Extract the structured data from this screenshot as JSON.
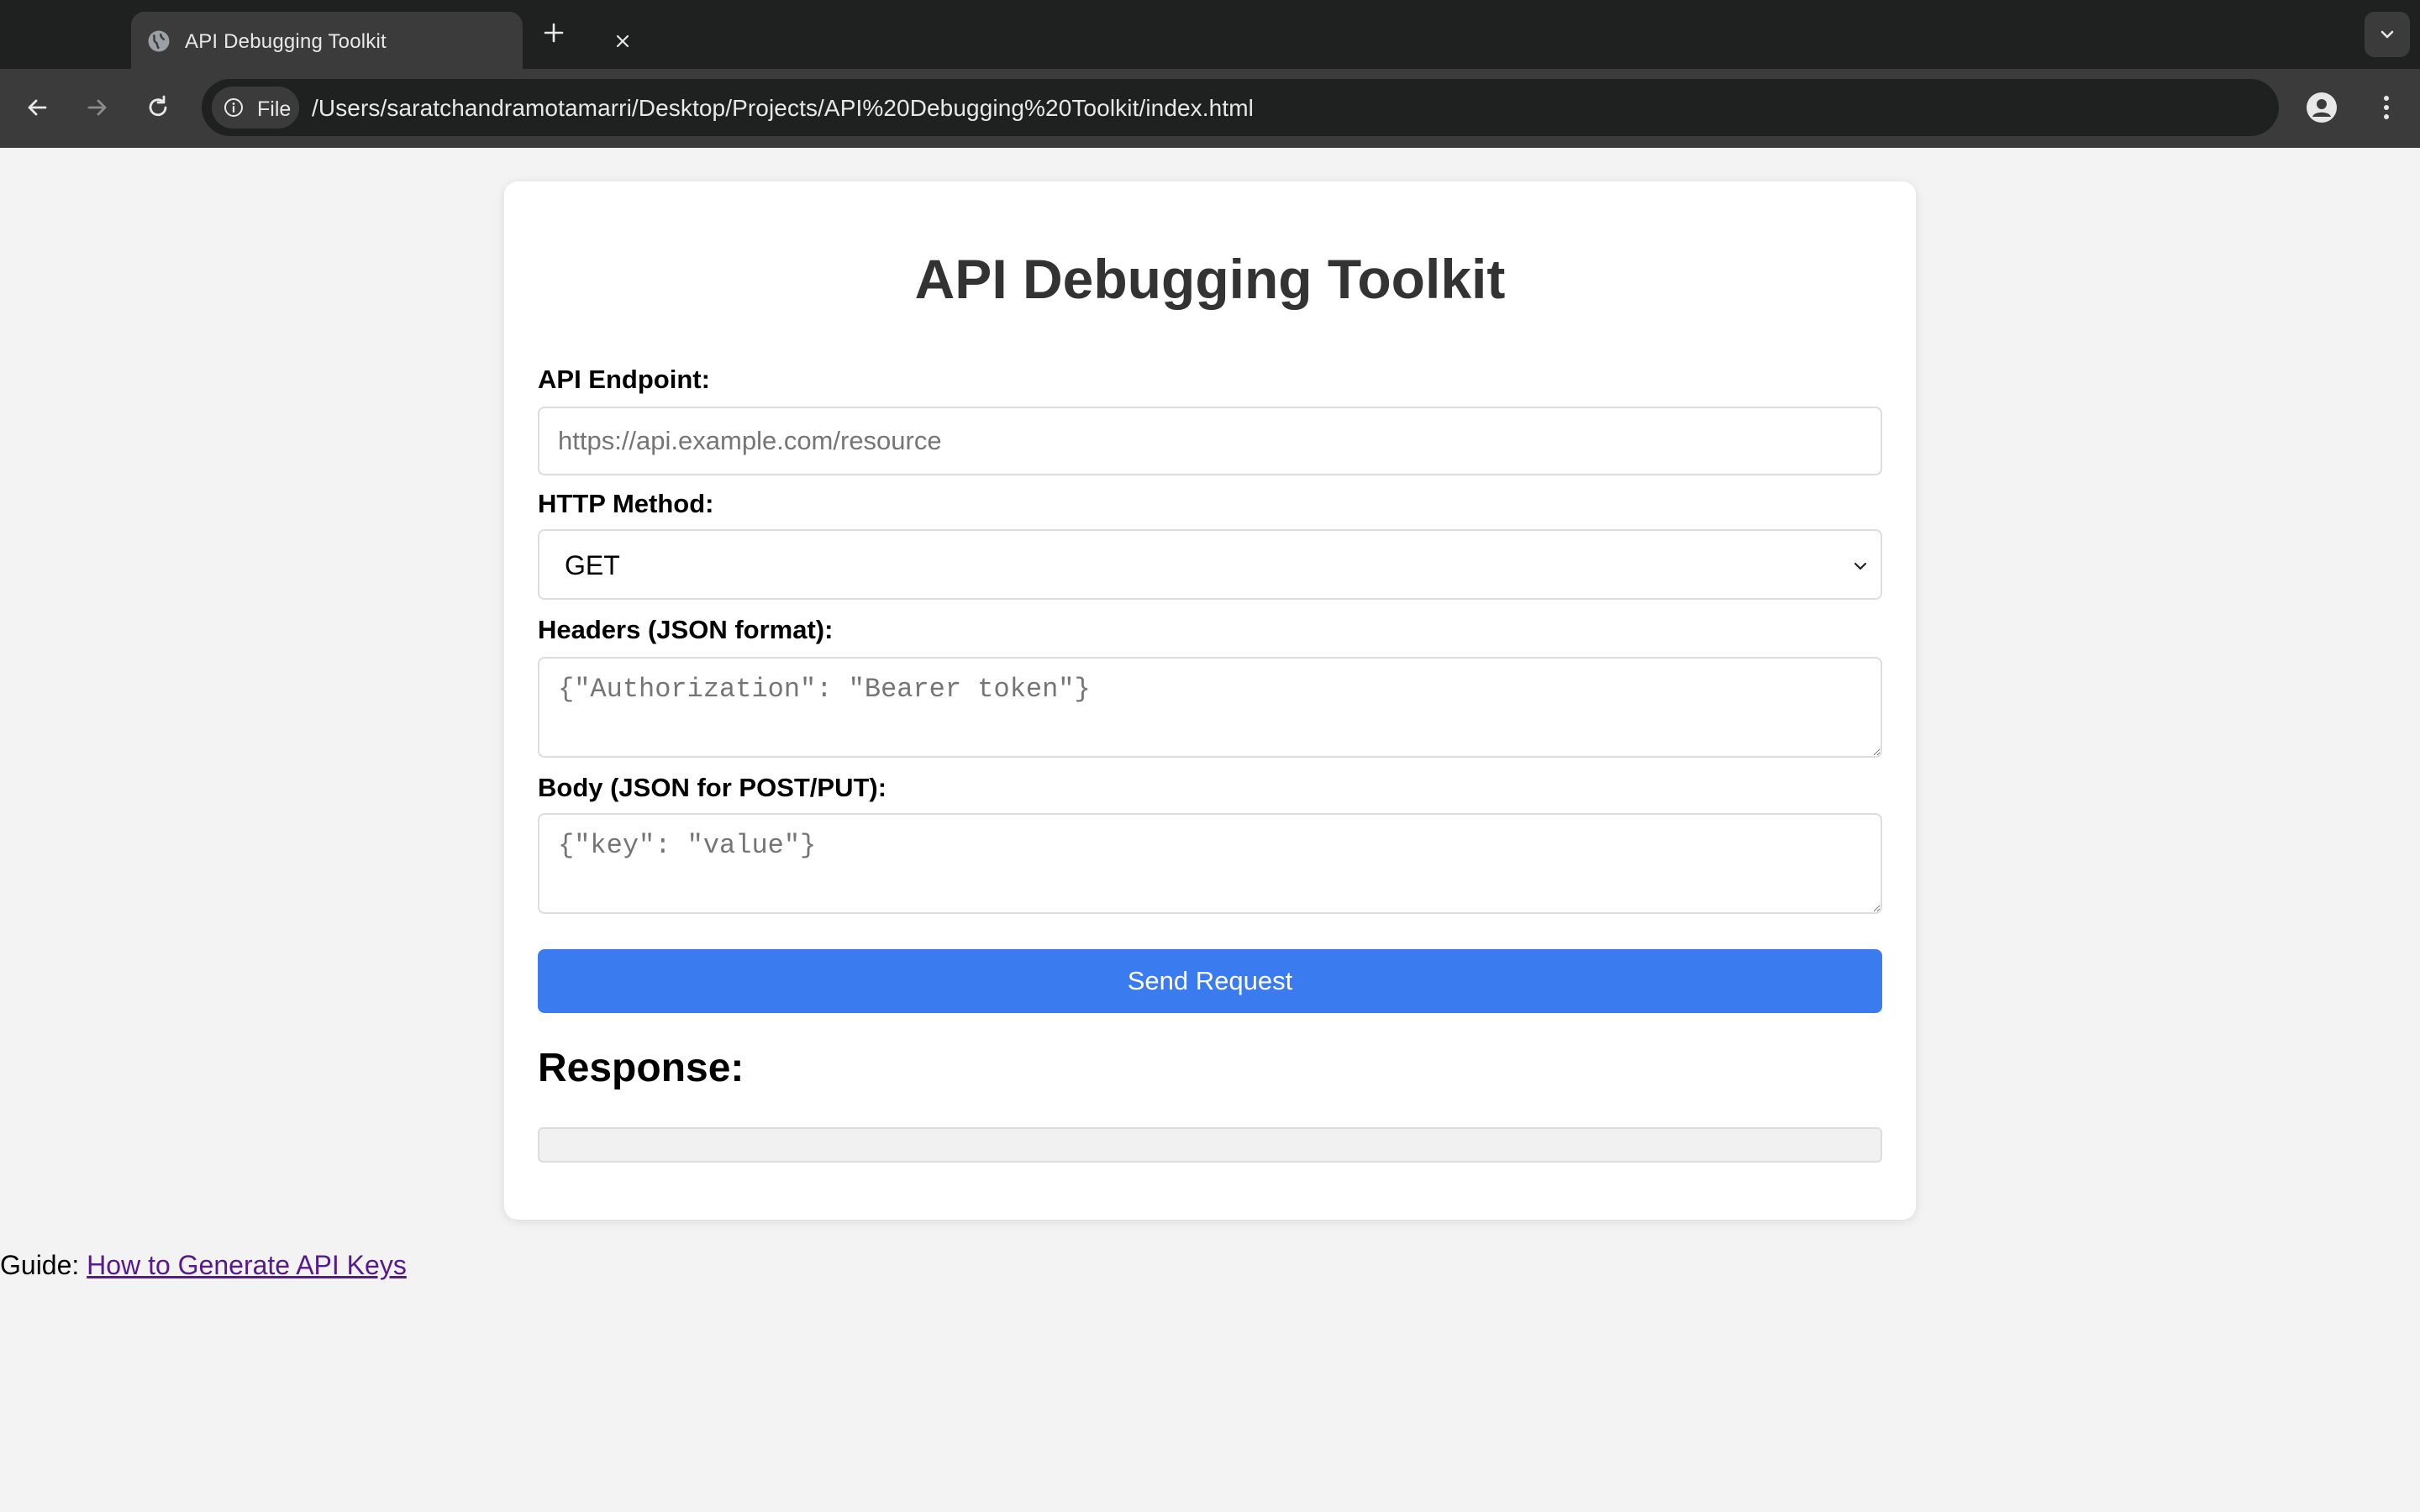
{
  "browser": {
    "tab": {
      "title": "API Debugging Toolkit",
      "favicon": "globe-icon"
    },
    "address_bar": {
      "scheme_chip": "File",
      "url": "/Users/saratchandramotamarri/Desktop/Projects/API%20Debugging%20Toolkit/index.html"
    },
    "icons": [
      "back-icon",
      "forward-icon",
      "reload-icon",
      "info-icon",
      "star-icon",
      "profile-icon",
      "kebab-menu-icon",
      "new-tab-icon",
      "tab-search-icon",
      "close-icon"
    ]
  },
  "page": {
    "title": "API Debugging Toolkit",
    "endpoint": {
      "label": "API Endpoint:",
      "placeholder": "https://api.example.com/resource",
      "value": ""
    },
    "method": {
      "label": "HTTP Method:",
      "selected": "GET"
    },
    "headers": {
      "label": "Headers (JSON format):",
      "placeholder": "{\"Authorization\": \"Bearer token\"}"
    },
    "body": {
      "label": "Body (JSON for POST/PUT):",
      "placeholder": "{\"key\": \"value\"}"
    },
    "send_button": "Send Request",
    "response": {
      "heading": "Response:",
      "content": ""
    },
    "guide": {
      "prefix": "Guide: ",
      "link_text": "How to Generate API Keys"
    }
  },
  "colors": {
    "page_background": "#f3f3f3",
    "card_background": "#ffffff",
    "button_accent": "#3b7bf0",
    "title_text": "#333333",
    "visited_link": "#551a8b"
  }
}
